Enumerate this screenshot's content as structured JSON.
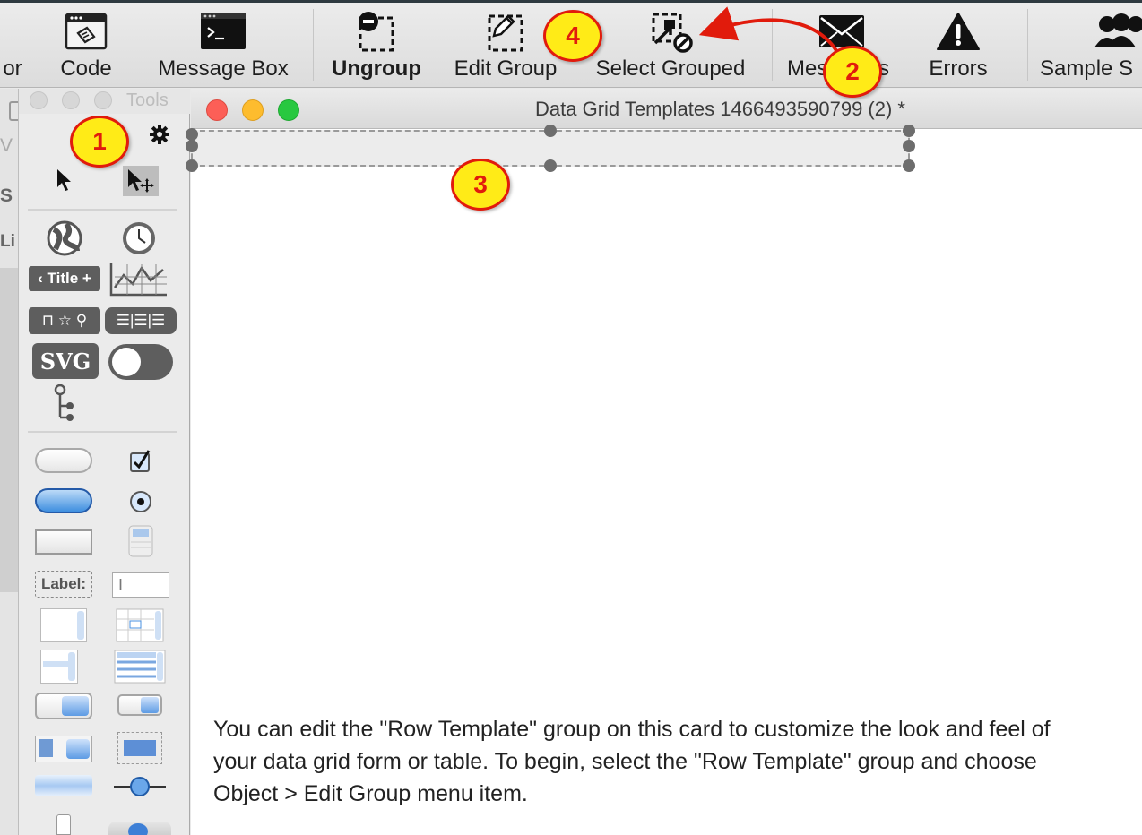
{
  "toolbar": {
    "items": [
      {
        "label": "or",
        "icon": "inspector-icon"
      },
      {
        "label": "Code",
        "icon": "code-icon"
      },
      {
        "label": "Message Box",
        "icon": "message-box-icon"
      },
      {
        "label": "Ungroup",
        "icon": "ungroup-icon"
      },
      {
        "label": "Edit Group",
        "icon": "edit-group-icon"
      },
      {
        "label": "Select Grouped",
        "icon": "select-grouped-icon"
      },
      {
        "label": "Mes",
        "label_end": "s",
        "icon": "messages-icon"
      },
      {
        "label": "Errors",
        "icon": "errors-icon"
      },
      {
        "label": "Sample S",
        "icon": "sample-stacks-icon"
      }
    ]
  },
  "back_window": {
    "fragments": [
      "V",
      "S",
      "Li"
    ]
  },
  "tools_palette": {
    "title": "Tools",
    "widgets": {
      "title_bar_label": "Title",
      "svg_label": "SVG",
      "label_field_text": "Label:"
    }
  },
  "stack_window": {
    "title": "Data Grid Templates 1466493590799 (2) *",
    "instructions": "You can edit the \"Row Template\" group on this card to customize the look and feel of your data grid form or table. To begin, select the \"Row Template\" group and choose Object > Edit Group menu item."
  },
  "callouts": [
    "1",
    "2",
    "3",
    "4"
  ],
  "colors": {
    "callout_fill": "#ffeb17",
    "callout_border": "#e11b0c",
    "close": "#fc5f57",
    "minimize": "#fdbc2e",
    "zoom": "#28c840"
  }
}
